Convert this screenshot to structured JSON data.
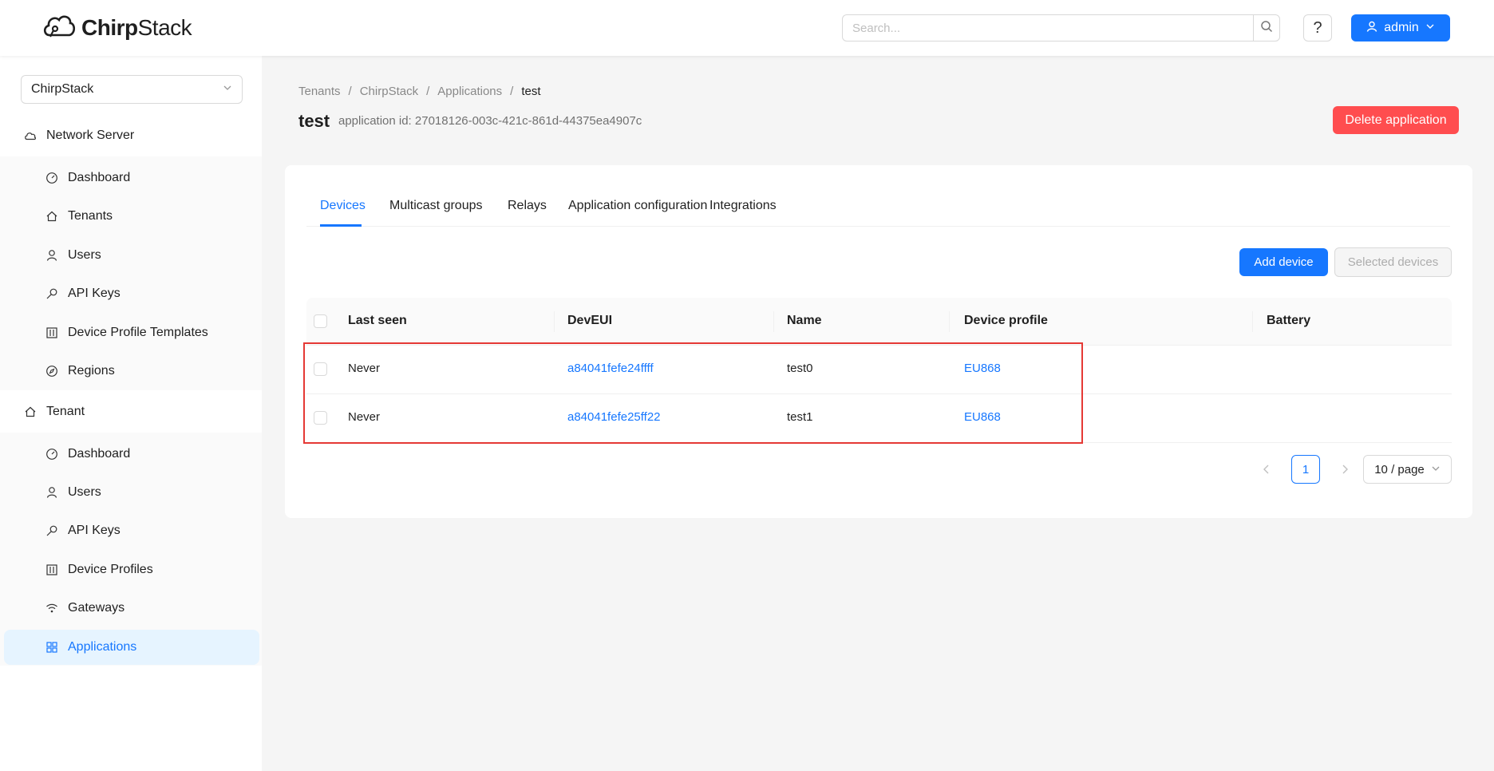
{
  "header": {
    "logo_text_bold": "Chirp",
    "logo_text_light": "Stack",
    "search_placeholder": "Search...",
    "help_label": "?",
    "user_label": "admin"
  },
  "sidebar": {
    "tenant_select": "ChirpStack",
    "network_server_title": "Network Server",
    "network_server_items": [
      {
        "label": "Dashboard",
        "icon": "dashboard-icon"
      },
      {
        "label": "Tenants",
        "icon": "home-icon"
      },
      {
        "label": "Users",
        "icon": "user-icon"
      },
      {
        "label": "API Keys",
        "icon": "key-icon"
      },
      {
        "label": "Device Profile Templates",
        "icon": "control-icon"
      },
      {
        "label": "Regions",
        "icon": "compass-icon"
      }
    ],
    "tenant_title": "Tenant",
    "tenant_items": [
      {
        "label": "Dashboard",
        "icon": "dashboard-icon"
      },
      {
        "label": "Users",
        "icon": "user-icon"
      },
      {
        "label": "API Keys",
        "icon": "key-icon"
      },
      {
        "label": "Device Profiles",
        "icon": "control-icon"
      },
      {
        "label": "Gateways",
        "icon": "wifi-icon"
      },
      {
        "label": "Applications",
        "icon": "appstore-icon"
      }
    ]
  },
  "breadcrumb": [
    "Tenants",
    "ChirpStack",
    "Applications",
    "test"
  ],
  "page": {
    "title": "test",
    "subtitle": "application id: 27018126-003c-421c-861d-44375ea4907c",
    "delete_label": "Delete application"
  },
  "tabs": [
    "Devices",
    "Multicast groups",
    "Relays",
    "Application configuration",
    "Integrations"
  ],
  "actions": {
    "add_device": "Add device",
    "selected_devices": "Selected devices"
  },
  "table": {
    "columns": [
      "Last seen",
      "DevEUI",
      "Name",
      "Device profile",
      "Battery"
    ],
    "rows": [
      {
        "last_seen": "Never",
        "dev_eui": "a84041fefe24ffff",
        "name": "test0",
        "device_profile": "EU868",
        "battery": ""
      },
      {
        "last_seen": "Never",
        "dev_eui": "a84041fefe25ff22",
        "name": "test1",
        "device_profile": "EU868",
        "battery": ""
      }
    ]
  },
  "pagination": {
    "current_page": "1",
    "page_size": "10 / page"
  },
  "colors": {
    "primary": "#1677ff",
    "danger": "#ff4d4f",
    "highlight": "#e53935"
  }
}
